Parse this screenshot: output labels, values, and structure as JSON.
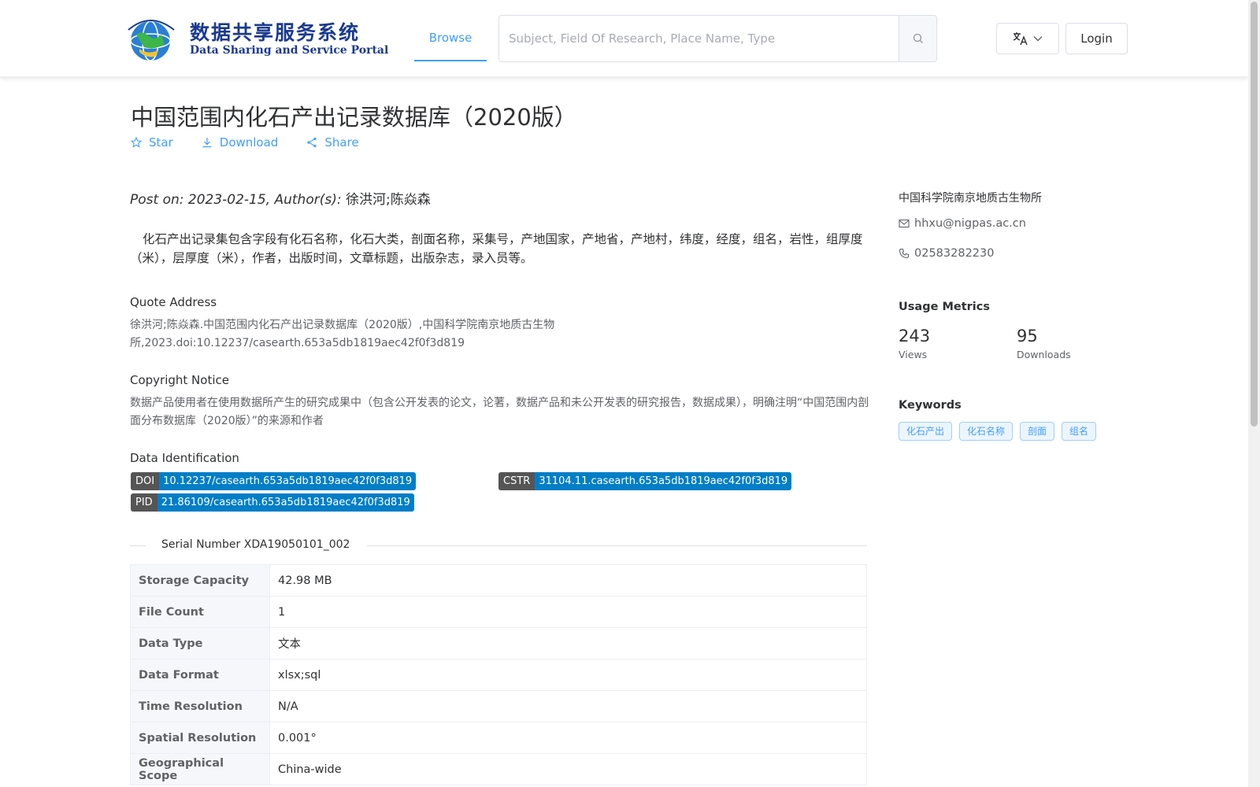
{
  "header": {
    "logo_cn": "数据共享服务系统",
    "logo_en": "Data Sharing and Service Portal",
    "nav_browse": "Browse",
    "search_placeholder": "Subject, Field Of Research, Place Name, Type",
    "login": "Login"
  },
  "dataset": {
    "title": "中国范围内化石产出记录数据库（2020版）",
    "actions": {
      "star": "Star",
      "download": "Download",
      "share": "Share"
    },
    "post_prefix": "Post on: 2023-02-15, Author(s): ",
    "authors": "徐洪河;陈焱森",
    "description": "化石产出记录集包含字段有化石名称，化石大类，剖面名称，采集号，产地国家，产地省，产地村，纬度，经度，组名，岩性，组厚度（米），层厚度（米），作者，出版时间，文章标题，出版杂志，录入员等。",
    "quote_title": "Quote Address",
    "quote_text": "徐洪河;陈焱森.中国范围内化石产出记录数据库（2020版）,中国科学院南京地质古生物所,2023.doi:10.12237/casearth.653a5db1819aec42f0f3d819",
    "copyright_title": "Copyright Notice",
    "copyright_text": "数据产品使用者在使用数据所产生的研究成果中（包含公开发表的论文，论著，数据产品和未公开发表的研究报告，数据成果），明确注明“中国范围内剖面分布数据库（2020版）”的来源和作者",
    "ident_title": "Data Identification",
    "doi_label": "DOI",
    "doi_value": "10.12237/casearth.653a5db1819aec42f0f3d819",
    "cstr_label": "CSTR",
    "cstr_value": "31104.11.casearth.653a5db1819aec42f0f3d819",
    "pid_label": "PID",
    "pid_value": "21.86109/casearth.653a5db1819aec42f0f3d819",
    "serial": "Serial Number XDA19050101_002",
    "table": [
      {
        "key": "Storage Capacity",
        "value": "42.98 MB"
      },
      {
        "key": "File Count",
        "value": "1"
      },
      {
        "key": "Data Type",
        "value": "文本"
      },
      {
        "key": "Data Format",
        "value": "xlsx;sql"
      },
      {
        "key": "Time Resolution",
        "value": "N/A"
      },
      {
        "key": "Spatial Resolution",
        "value": "0.001°"
      },
      {
        "key": "Geographical Scope",
        "value": "China-wide"
      }
    ]
  },
  "sidebar": {
    "org": "中国科学院南京地质古生物所",
    "email": "hhxu@nigpas.ac.cn",
    "phone": "02583282230",
    "metrics_title": "Usage Metrics",
    "views_num": "243",
    "views_label": "Views",
    "downloads_num": "95",
    "downloads_label": "Downloads",
    "keywords_title": "Keywords",
    "keywords": [
      "化石产出",
      "化石名称",
      "剖面",
      "组名"
    ]
  },
  "colors": {
    "accent": "#409eff",
    "badge_key": "#555555",
    "badge_value": "#007ec6"
  }
}
